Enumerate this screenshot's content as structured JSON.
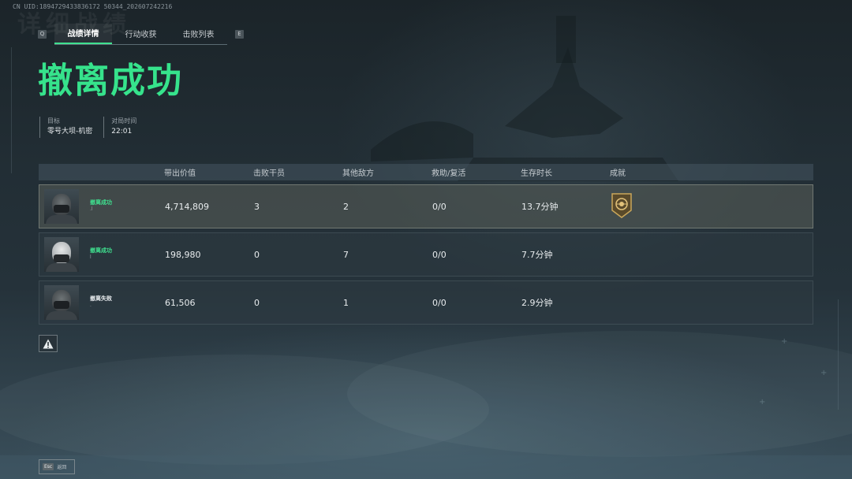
{
  "uid": "CN UID:1894729433836172 50344_202607242216",
  "bg_title": "详细战绩",
  "tabs": {
    "left_key": "Q",
    "right_key": "E",
    "items": [
      "战绩详情",
      "行动收获",
      "击败列表"
    ]
  },
  "headline": "撤离成功",
  "meta": {
    "target_label": "目标",
    "target_value": "零号大坝-机密",
    "time_label": "对局时间",
    "time_value": "22:01"
  },
  "table": {
    "headers": [
      "",
      "带出价值",
      "击败干员",
      "其他敌方",
      "救助/复活",
      "生存时长",
      "成就"
    ],
    "rows": [
      {
        "status": "撤离成功",
        "status_type": "success",
        "name": ".l",
        "value": "4,714,809",
        "kills": "3",
        "enemies": "2",
        "rescue": "0/0",
        "survival": "13.7分钟",
        "achievement": "medal-icon"
      },
      {
        "status": "撤离成功",
        "status_type": "success",
        "name": "l",
        "value": "198,980",
        "kills": "0",
        "enemies": "7",
        "rescue": "0/0",
        "survival": "7.7分钟",
        "achievement": ""
      },
      {
        "status": "撤离失败",
        "status_type": "fail",
        "name": ".",
        "value": "61,506",
        "kills": "0",
        "enemies": "1",
        "rescue": "0/0",
        "survival": "2.9分钟",
        "achievement": ""
      }
    ]
  },
  "footer": {
    "esc_key": "Esc",
    "back_label": "返回"
  },
  "colors": {
    "accent": "#36e38c",
    "background": "#222e35"
  }
}
